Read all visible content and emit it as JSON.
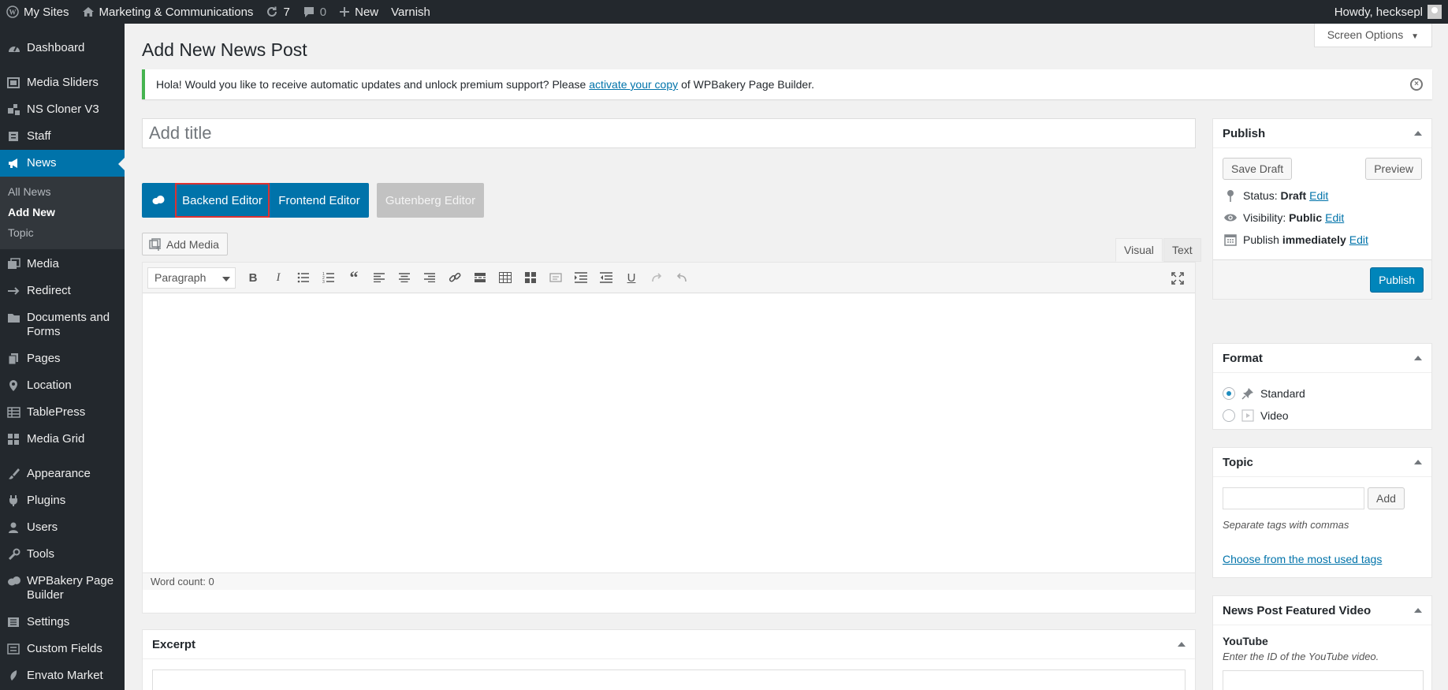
{
  "adminbar": {
    "my_sites": "My Sites",
    "site_name": "Marketing & Communications",
    "updates_count": "7",
    "comments_count": "0",
    "new_label": "New",
    "varnish_label": "Varnish",
    "howdy": "Howdy, hecksepl"
  },
  "sidebar": {
    "items": [
      {
        "label": "Dashboard",
        "icon": "dashboard-icon"
      },
      {
        "label": "Media Sliders",
        "icon": "slides-icon"
      },
      {
        "label": "NS Cloner V3",
        "icon": "cloner-icon"
      },
      {
        "label": "Staff",
        "icon": "staff-icon"
      },
      {
        "label": "News",
        "icon": "megaphone-icon"
      },
      {
        "label": "Media",
        "icon": "media-icon"
      },
      {
        "label": "Redirect",
        "icon": "redirect-icon"
      },
      {
        "label": "Documents and Forms",
        "icon": "folder-icon"
      },
      {
        "label": "Pages",
        "icon": "pages-icon"
      },
      {
        "label": "Location",
        "icon": "location-icon"
      },
      {
        "label": "TablePress",
        "icon": "table-icon"
      },
      {
        "label": "Media Grid",
        "icon": "grid-icon"
      },
      {
        "label": "Appearance",
        "icon": "brush-icon"
      },
      {
        "label": "Plugins",
        "icon": "plugin-icon"
      },
      {
        "label": "Users",
        "icon": "users-icon"
      },
      {
        "label": "Tools",
        "icon": "wrench-icon"
      },
      {
        "label": "WPBakery Page Builder",
        "icon": "wpbakery-icon"
      },
      {
        "label": "Settings",
        "icon": "settings-icon"
      },
      {
        "label": "Custom Fields",
        "icon": "fields-icon"
      },
      {
        "label": "Envato Market",
        "icon": "envato-icon"
      }
    ],
    "submenu": [
      "All News",
      "Add New",
      "Topic"
    ]
  },
  "main": {
    "screen_options": "Screen Options",
    "page_title": "Add New News Post",
    "notice": {
      "before": "Hola! Would you like to receive automatic updates and unlock premium support? Please",
      "link": "activate your copy",
      "after": "of WPBakery Page Builder."
    },
    "title_placeholder": "Add title",
    "editor_buttons": {
      "backend": "Backend Editor",
      "frontend": "Frontend Editor",
      "gutenberg": "Gutenberg Editor"
    },
    "add_media": "Add Media",
    "tabs": {
      "visual": "Visual",
      "text": "Text"
    },
    "format_select": "Paragraph",
    "word_count": "Word count: 0",
    "excerpt_title": "Excerpt"
  },
  "publish": {
    "title": "Publish",
    "save_draft": "Save Draft",
    "preview": "Preview",
    "status_label": "Status:",
    "status_value": "Draft",
    "visibility_label": "Visibility:",
    "visibility_value": "Public",
    "publish_label": "Publish",
    "publish_value": "immediately",
    "edit": "Edit",
    "publish_button": "Publish"
  },
  "format": {
    "title": "Format",
    "options": [
      "Standard",
      "Video"
    ]
  },
  "topic": {
    "title": "Topic",
    "add": "Add",
    "hint": "Separate tags with commas",
    "link": "Choose from the most used tags"
  },
  "video": {
    "title": "News Post Featured Video",
    "youtube_label": "YouTube",
    "youtube_hint": "Enter the ID of the YouTube video."
  },
  "colors": {
    "admin_dark": "#23282d",
    "accent": "#0073aa",
    "highlight_border": "#dc3232",
    "notice_success": "#46b450"
  }
}
